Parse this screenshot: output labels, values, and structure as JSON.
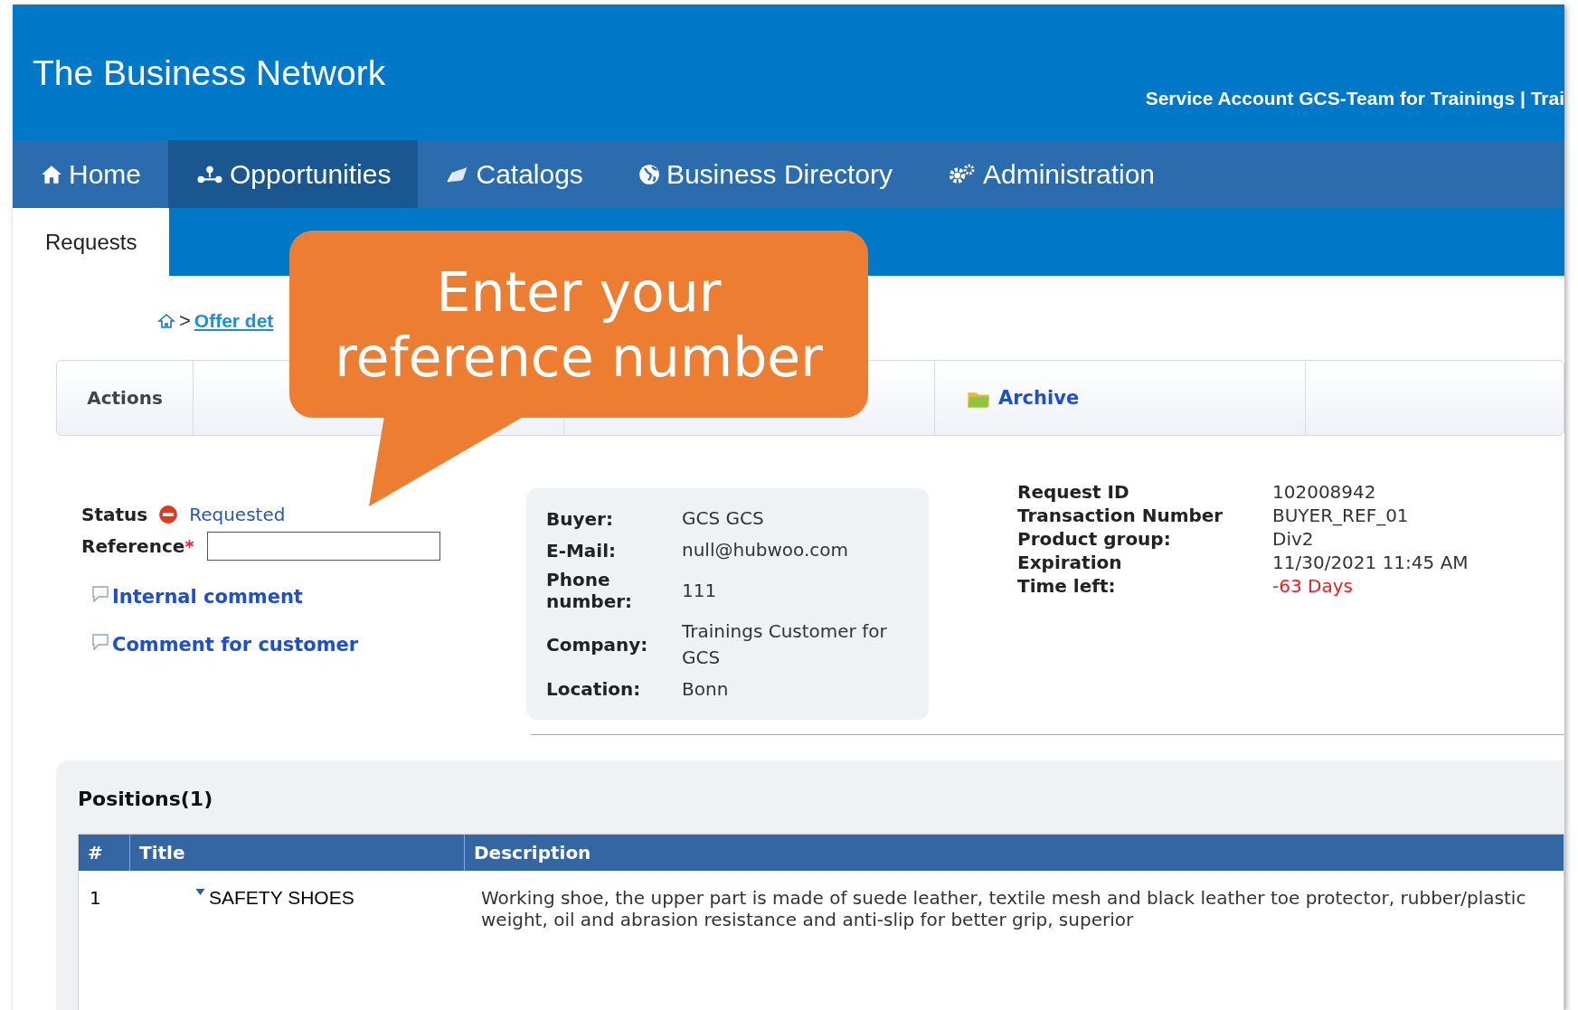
{
  "header": {
    "title": "The Business Network",
    "account": "Service Account GCS-Team for Trainings | Trai"
  },
  "nav": [
    {
      "label": "Home",
      "kind": "home",
      "selected": false
    },
    {
      "label": "Opportunities",
      "kind": "network",
      "selected": true
    },
    {
      "label": "Catalogs",
      "kind": "catalog",
      "selected": false
    },
    {
      "label": "Business Directory",
      "kind": "globe",
      "selected": false
    },
    {
      "label": "Administration",
      "kind": "gears",
      "selected": false
    }
  ],
  "subtabs": [
    {
      "label": "Requests",
      "selected": true
    }
  ],
  "breadcrumb": {
    "sep": ">",
    "link": "Offer det"
  },
  "actions": {
    "label": "Actions",
    "items": [
      {
        "label": "Archive"
      }
    ]
  },
  "status": {
    "label": "Status",
    "value": "Requested",
    "reference_label": "Reference",
    "required_mark": "*"
  },
  "comment_links": [
    {
      "label": "Internal comment"
    },
    {
      "label": "Comment for customer"
    }
  ],
  "buyer": [
    {
      "label": "Buyer:",
      "value": "GCS GCS"
    },
    {
      "label": "E-Mail:",
      "value": "null@hubwoo.com"
    },
    {
      "label": "Phone number:",
      "value": "111"
    },
    {
      "label": "Company:",
      "value": "Trainings Customer for GCS"
    },
    {
      "label": "Location:",
      "value": "Bonn"
    }
  ],
  "request": [
    {
      "label": "Request ID",
      "value": "102008942",
      "alert": false
    },
    {
      "label": "Transaction Number",
      "value": "BUYER_REF_01",
      "alert": false
    },
    {
      "label": "Product group:",
      "value": "Div2",
      "alert": false
    },
    {
      "label": "Expiration",
      "value": "11/30/2021 11:45 AM",
      "alert": false
    },
    {
      "label": "Time left:",
      "value": "-63 Days",
      "alert": true
    }
  ],
  "positions": {
    "title": "Positions(1)",
    "columns": [
      "#",
      "Title",
      "Description"
    ],
    "rows": [
      {
        "number": "1",
        "title": "SAFETY SHOES",
        "expanded": true,
        "description": "Working shoe, the upper part is made of suede leather, textile mesh and black leather toe protector, rubber/plastic weight, oil and abrasion resistance and anti-slip for better grip, superior"
      }
    ]
  },
  "callout": {
    "text": "Enter your reference number"
  }
}
